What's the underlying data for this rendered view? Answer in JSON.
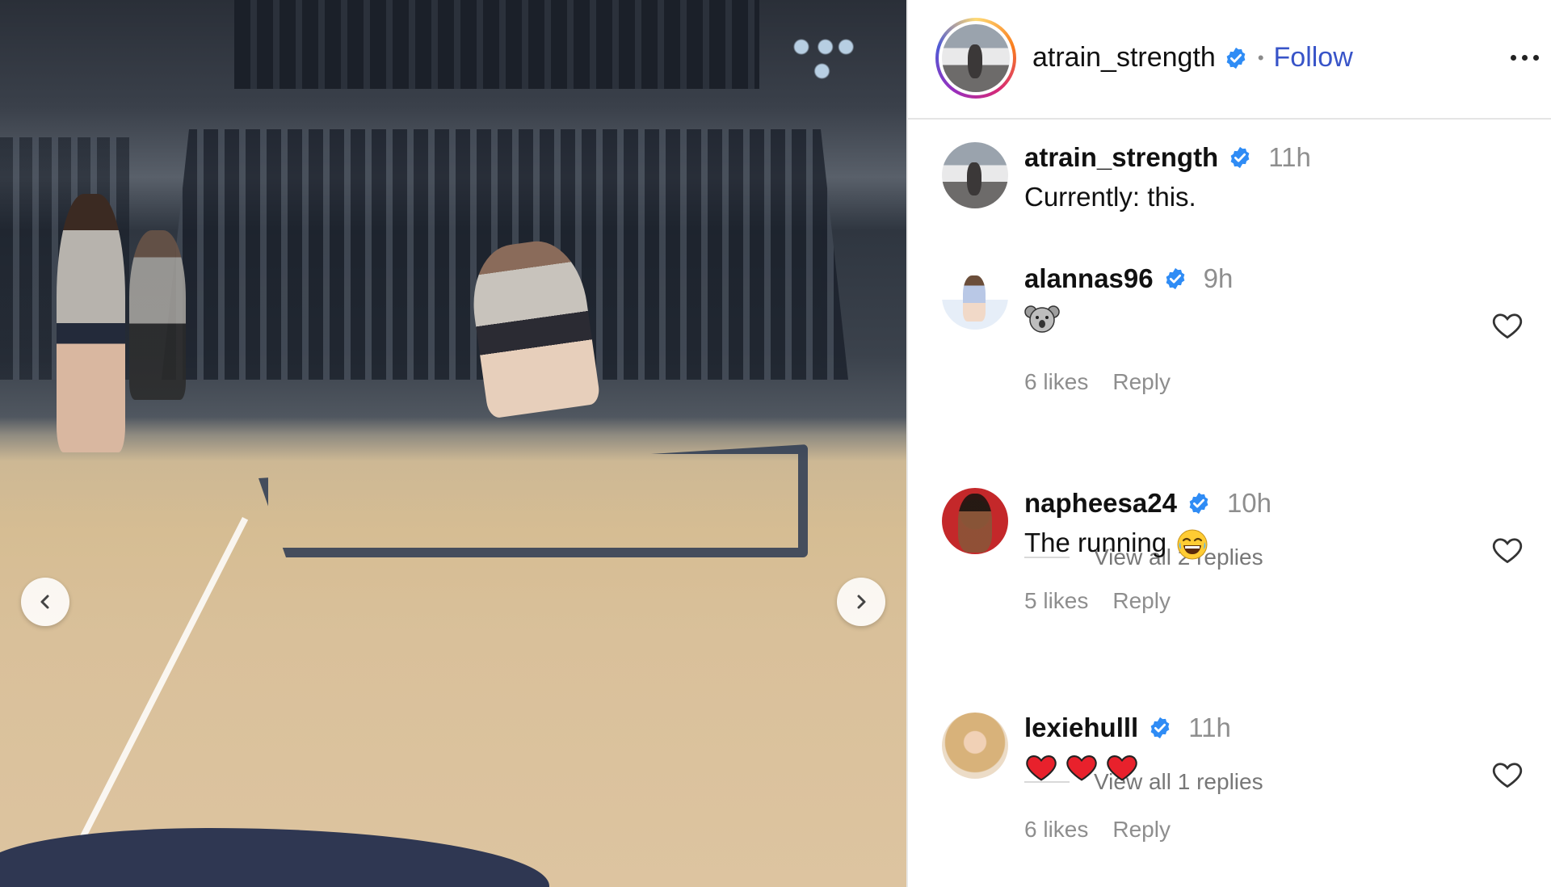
{
  "post": {
    "author": "atrain_strength",
    "follow_label": "Follow",
    "separator": "•"
  },
  "media": {
    "prev_icon": "chevron-left-icon",
    "next_icon": "chevron-right-icon"
  },
  "comments": [
    {
      "user": "atrain_strength",
      "time": "11h",
      "text": "Currently: this."
    },
    {
      "user": "alannas96",
      "time": "9h",
      "text": "",
      "emoji": "koala-emoji",
      "likes": "6 likes",
      "reply_label": "Reply",
      "view_replies": "View all 2 replies"
    },
    {
      "user": "napheesa24",
      "time": "10h",
      "text": "The running",
      "emoji": "laughing-emoji",
      "likes": "5 likes",
      "reply_label": "Reply",
      "view_replies": "View all 1 replies"
    },
    {
      "user": "lexiehulll",
      "time": "11h",
      "text": "",
      "emoji": "three-red-hearts",
      "likes": "6 likes",
      "reply_label": "Reply"
    }
  ],
  "colors": {
    "follow_blue": "#3854c8",
    "verified_blue": "#2f8cf5",
    "muted_text": "#8e8e8e"
  }
}
